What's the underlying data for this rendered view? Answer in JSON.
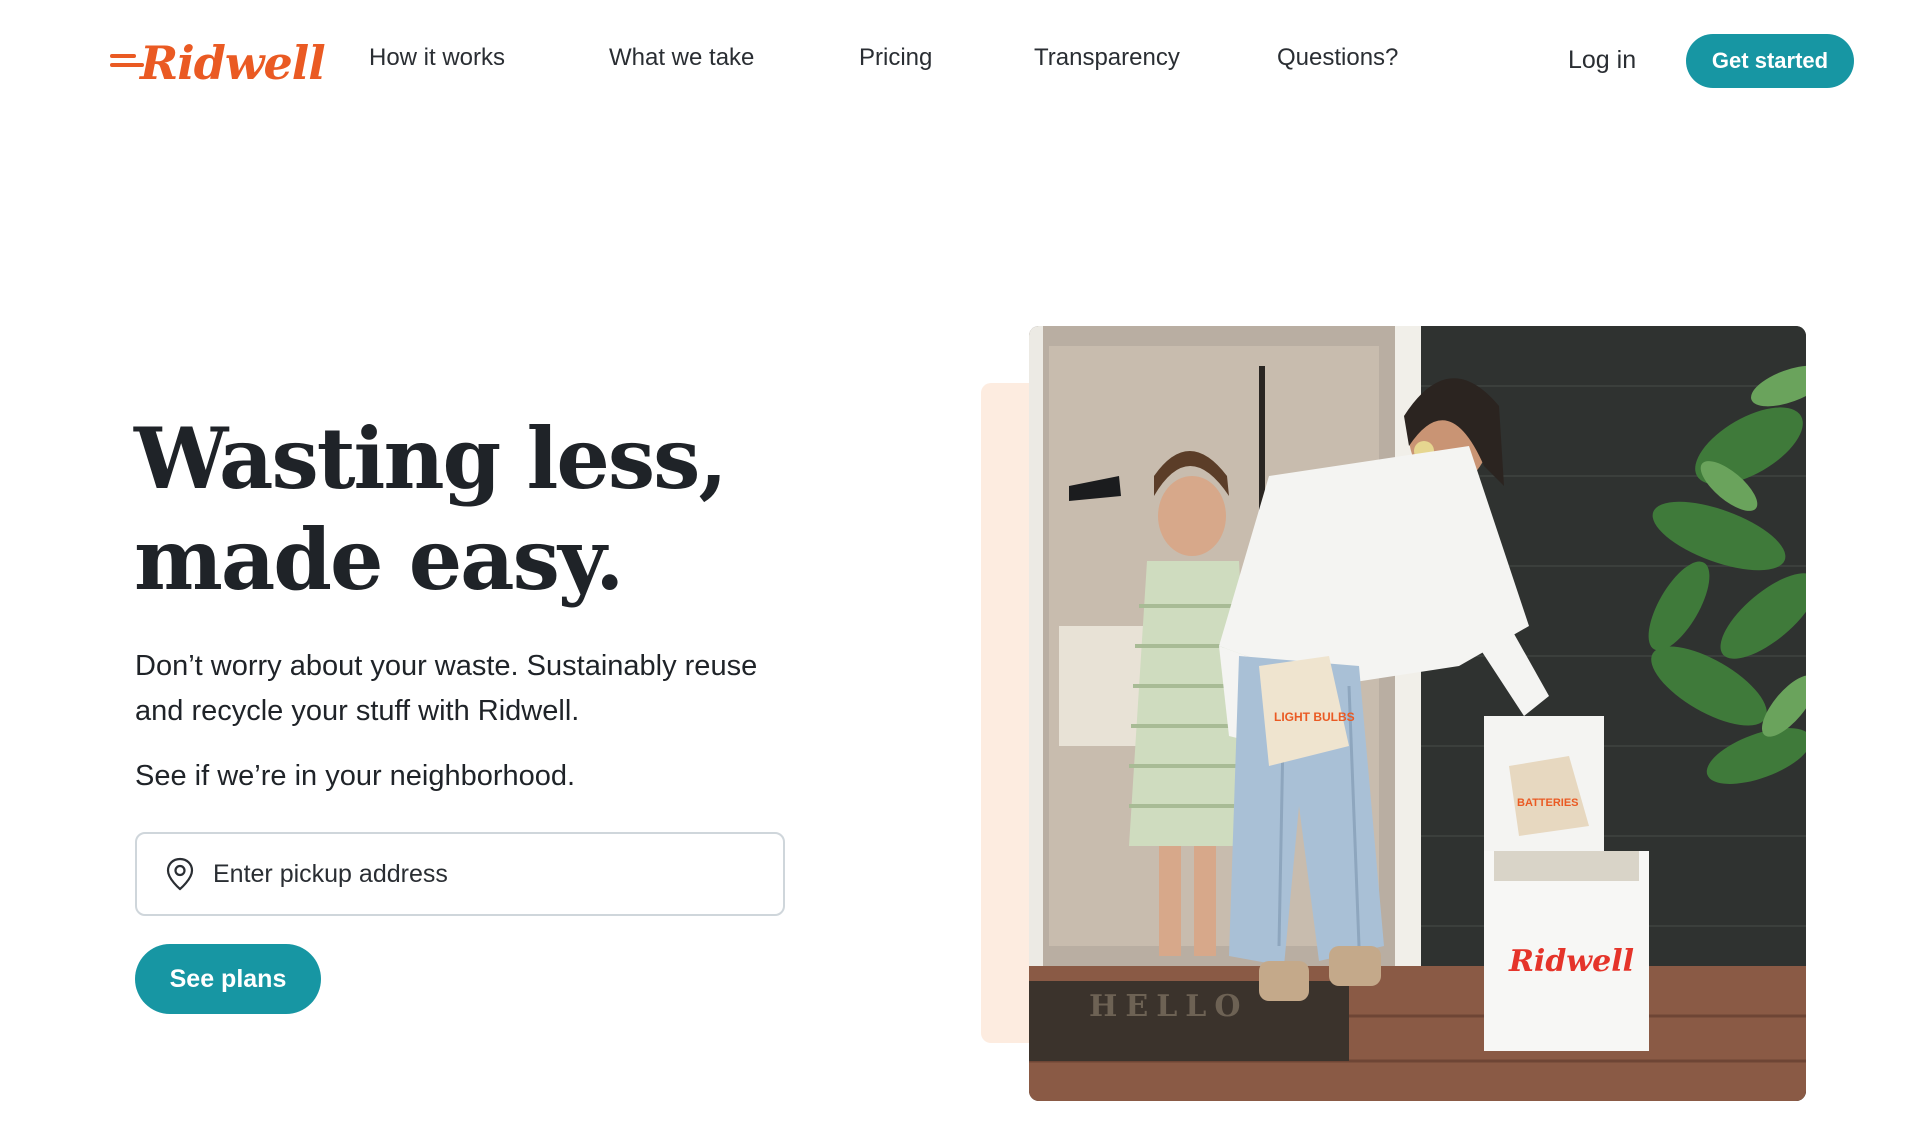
{
  "brand": {
    "logo_text": "Ridwell",
    "accent_color": "#ea5a23",
    "primary_color": "#1796a3"
  },
  "nav": {
    "items": [
      {
        "label": "How it works"
      },
      {
        "label": "What we take"
      },
      {
        "label": "Pricing"
      },
      {
        "label": "Transparency"
      },
      {
        "label": "Questions?"
      }
    ],
    "login_label": "Log in",
    "cta_label": "Get started"
  },
  "hero": {
    "headline_line1": "Wasting less,",
    "headline_line2": "made easy.",
    "subtext_line1": "Don’t worry about your waste. Sustainably reuse",
    "subtext_line2": "and recycle your stuff with Ridwell.",
    "neighborhood_prompt": "See if we’re in your neighborhood.",
    "address_placeholder": "Enter pickup address",
    "address_icon": "location-pin-icon",
    "button_label": "See plans"
  },
  "photo": {
    "bag_label_front": "LIGHT BULBS",
    "bag_label_box": "BATTERIES",
    "box_logo_text": "Ridwell"
  }
}
